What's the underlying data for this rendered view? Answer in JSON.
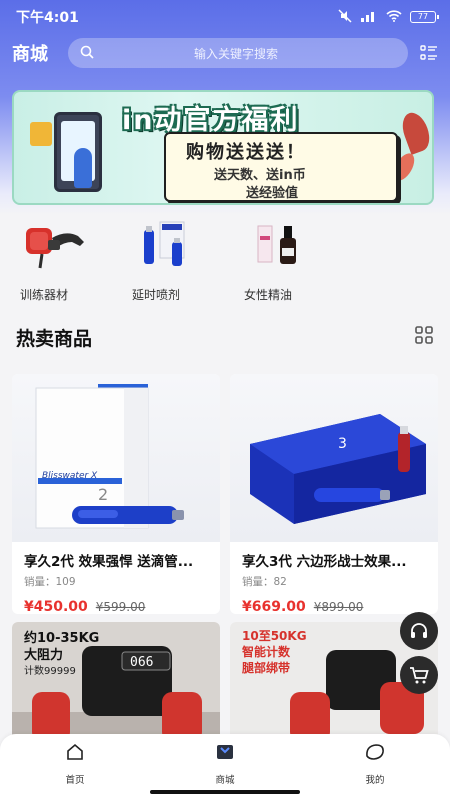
{
  "status_bar": {
    "time": "下午4:01",
    "battery": "77"
  },
  "header": {
    "title": "商城",
    "search_placeholder": "输入关键字搜索"
  },
  "banner": {
    "headline": "in动官方福利",
    "line1": "购物送送送！",
    "line2": "送天数、送in币",
    "line3": "送经验值"
  },
  "categories": [
    {
      "label": "训练器材",
      "icon": "training-equipment"
    },
    {
      "label": "延时喷剂",
      "icon": "delay-spray"
    },
    {
      "label": "女性精油",
      "icon": "female-essential-oil"
    }
  ],
  "section": {
    "title": "热卖商品"
  },
  "products": [
    {
      "name": "享久2代 效果强悍 送滴管...",
      "sales": "销量：109",
      "price": "¥450.00",
      "orig": "¥599.00",
      "box_text": "Blisswater X",
      "box_num": "2"
    },
    {
      "name": "享久3代 六边形战士效果...",
      "sales": "销量：82",
      "price": "¥669.00",
      "orig": "¥899.00",
      "box_text": "3",
      "box_num": ""
    }
  ],
  "products_partial": [
    {
      "line1": "约10-35KG",
      "line2": "大阻力",
      "line3": "计数99999",
      "display": "066"
    },
    {
      "line1": "10至50KG",
      "line2": "智能计数",
      "line3": "腿部绑带"
    }
  ],
  "tabbar": [
    {
      "label": "首页",
      "icon": "home-icon"
    },
    {
      "label": "商城",
      "icon": "shop-icon"
    },
    {
      "label": "我的",
      "icon": "profile-icon"
    }
  ],
  "colors": {
    "accent": "#5b6ee8",
    "price": "#e8322e"
  }
}
